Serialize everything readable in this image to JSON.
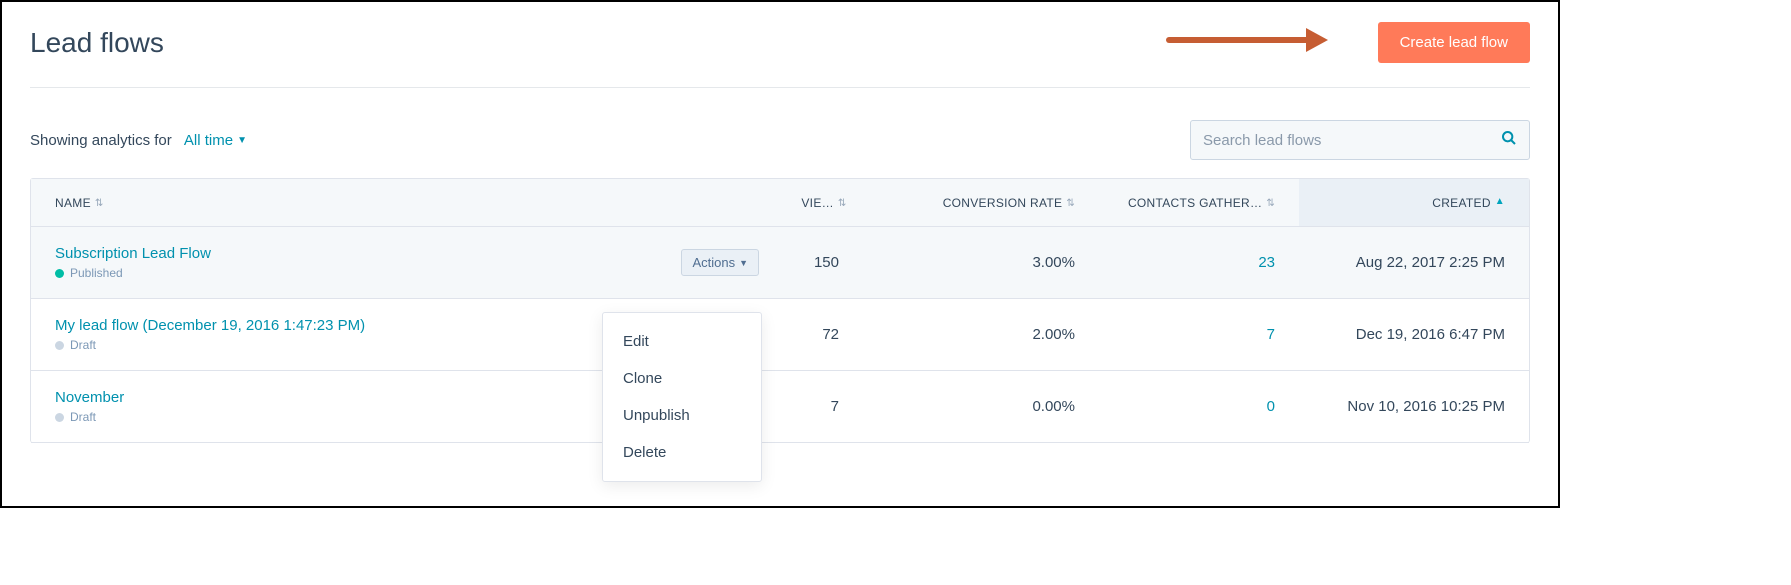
{
  "header": {
    "title": "Lead flows",
    "create_button": "Create lead flow"
  },
  "filter": {
    "prefix": "Showing analytics for",
    "value": "All time"
  },
  "search": {
    "placeholder": "Search lead flows"
  },
  "columns": {
    "name": "NAME",
    "views": "VIE…",
    "conversion": "CONVERSION RATE",
    "contacts": "CONTACTS GATHER…",
    "created": "CREATED"
  },
  "sort": {
    "column": "created",
    "direction": "asc"
  },
  "actions": {
    "label": "Actions",
    "items": [
      "Edit",
      "Clone",
      "Unpublish",
      "Delete"
    ]
  },
  "colors": {
    "accent": "#ff7a59",
    "link": "#0091ae",
    "published": "#00bda5"
  },
  "rows": [
    {
      "name": "Subscription Lead Flow",
      "status": "Published",
      "status_kind": "published",
      "views": "150",
      "conversion_rate": "3.00%",
      "contacts": "23",
      "created": "Aug 22, 2017 2:25 PM",
      "hovered": true,
      "show_actions_button": true
    },
    {
      "name": "My lead flow (December 19, 2016 1:47:23 PM)",
      "status": "Draft",
      "status_kind": "draft",
      "views": "72",
      "conversion_rate": "2.00%",
      "contacts": "7",
      "created": "Dec 19, 2016 6:47 PM",
      "hovered": false,
      "show_actions_button": false
    },
    {
      "name": "November",
      "status": "Draft",
      "status_kind": "draft",
      "views": "7",
      "conversion_rate": "0.00%",
      "contacts": "0",
      "created": "Nov 10, 2016 10:25 PM",
      "hovered": false,
      "show_actions_button": false
    }
  ]
}
